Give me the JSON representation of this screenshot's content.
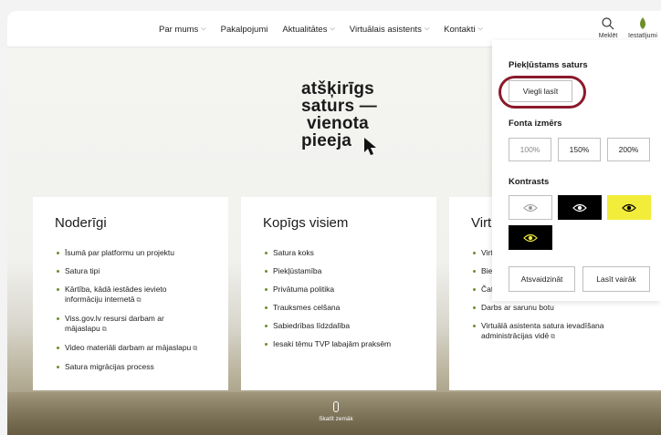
{
  "nav": {
    "items": [
      {
        "label": "Par mums",
        "has_dropdown": true
      },
      {
        "label": "Pakalpojumi",
        "has_dropdown": false
      },
      {
        "label": "Aktualitātes",
        "has_dropdown": true
      },
      {
        "label": "Virtuālais asistents",
        "has_dropdown": true
      },
      {
        "label": "Kontakti",
        "has_dropdown": true
      }
    ],
    "search_label": "Meklēt",
    "settings_label": "Iestatījumi"
  },
  "hero": {
    "lines": [
      "atšķirīgs",
      "saturs —",
      "vienota",
      "pieeja"
    ]
  },
  "cards": [
    {
      "title": "Noderīgi",
      "items": [
        {
          "text": "Īsumā par platformu un projektu",
          "external": false
        },
        {
          "text": "Satura tipi",
          "external": false
        },
        {
          "text": "Kārtība, kādā iestādes ievieto informāciju internetā",
          "external": true
        },
        {
          "text": "Viss.gov.lv resursi darbam ar mājaslapu",
          "external": true
        },
        {
          "text": "Video materiāli darbam ar mājaslapu",
          "external": true
        },
        {
          "text": "Satura migrācijas process",
          "external": false
        }
      ]
    },
    {
      "title": "Kopīgs visiem",
      "items": [
        {
          "text": "Satura koks",
          "external": false
        },
        {
          "text": "Piekļūstamība",
          "external": false
        },
        {
          "text": "Privātuma politika",
          "external": false
        },
        {
          "text": "Trauksmes celšana",
          "external": false
        },
        {
          "text": "Sabiedrības līdzdalība",
          "external": false
        },
        {
          "text": "Iesaki tēmu TVP labajām praksēm",
          "external": false
        }
      ]
    },
    {
      "title": "Virtu",
      "items": [
        {
          "text": "Virtu",
          "external": false
        },
        {
          "text": "Biežā",
          "external": false
        },
        {
          "text": "Čatb",
          "external": false
        },
        {
          "text": "Darbs ar sarunu botu",
          "external": false
        },
        {
          "text": "Virtuālā asistenta satura ievadīšana administrācijas vidē",
          "external": true
        }
      ]
    }
  ],
  "scroll_hint": "Skatīt zemāk",
  "settings_panel": {
    "accessible_title": "Piekļūstams saturs",
    "easy_read_label": "Viegli lasīt",
    "font_size_title": "Fonta izmērs",
    "font_sizes": [
      "100%",
      "150%",
      "200%"
    ],
    "contrast_title": "Kontrasts",
    "contrast_options": [
      {
        "icon": "eye-icon",
        "background": "#ffffff",
        "foreground": "#999999"
      },
      {
        "icon": "eye-icon",
        "background": "#000000",
        "foreground": "#ffffff"
      },
      {
        "icon": "eye-icon",
        "background": "#f2ec3a",
        "foreground": "#000000"
      },
      {
        "icon": "eye-icon",
        "background": "#000000",
        "foreground": "#f2ec3a"
      }
    ],
    "reset_label": "Atsvaidzināt",
    "read_more_label": "Lasīt vairāk"
  },
  "colors": {
    "accent": "#8b1a2b",
    "bullet": "#6b8f2a"
  }
}
